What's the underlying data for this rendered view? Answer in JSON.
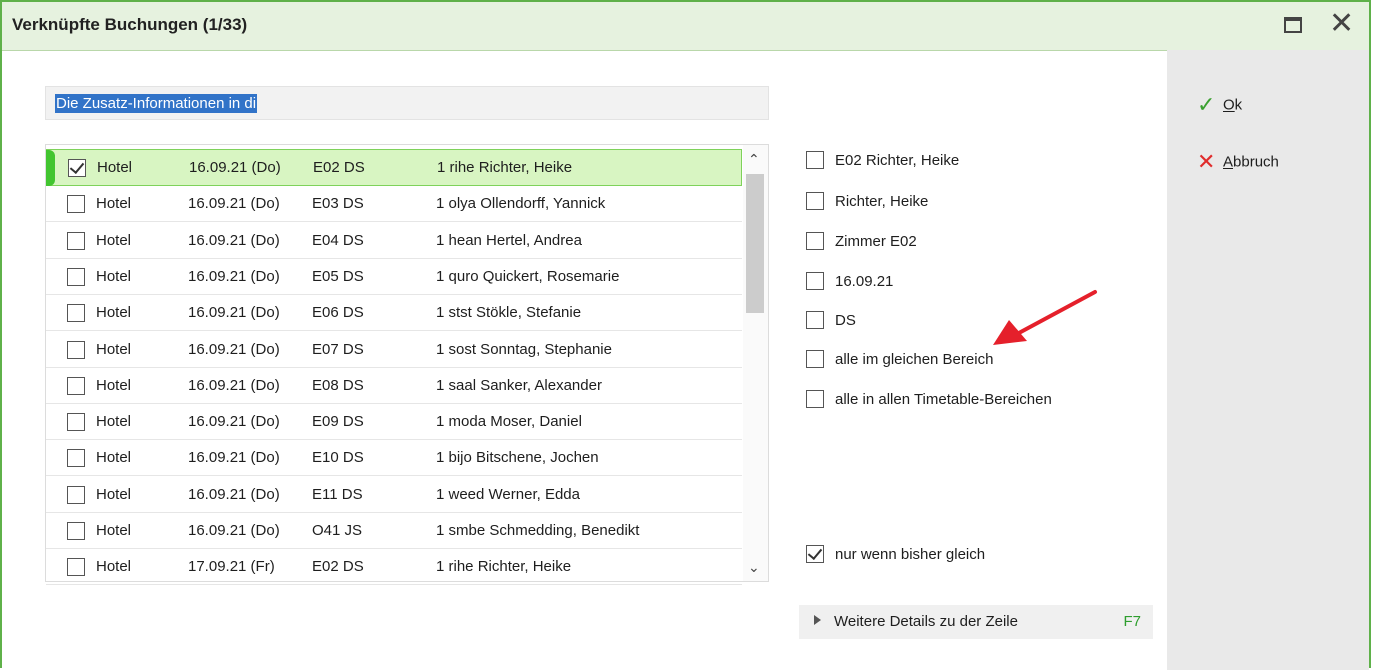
{
  "window": {
    "title": "Verknüpfte Buchungen (1/33)"
  },
  "info": {
    "selected_text": "Die Zusatz-Informationen in di"
  },
  "bookings": [
    {
      "type": "Hotel",
      "date": "16.09.21 (Do)",
      "room": "E02 DS",
      "guest": "1 rihe  Richter, Heike",
      "checked": true
    },
    {
      "type": "Hotel",
      "date": "16.09.21 (Do)",
      "room": "E03 DS",
      "guest": "1 olya  Ollendorff, Yannick",
      "checked": false
    },
    {
      "type": "Hotel",
      "date": "16.09.21 (Do)",
      "room": "E04 DS",
      "guest": "1 hean  Hertel, Andrea",
      "checked": false
    },
    {
      "type": "Hotel",
      "date": "16.09.21 (Do)",
      "room": "E05 DS",
      "guest": "1 quro  Quickert, Rosemarie",
      "checked": false
    },
    {
      "type": "Hotel",
      "date": "16.09.21 (Do)",
      "room": "E06 DS",
      "guest": "1 stst  Stökle, Stefanie",
      "checked": false
    },
    {
      "type": "Hotel",
      "date": "16.09.21 (Do)",
      "room": "E07 DS",
      "guest": "1 sost  Sonntag, Stephanie",
      "checked": false
    },
    {
      "type": "Hotel",
      "date": "16.09.21 (Do)",
      "room": "E08 DS",
      "guest": "1 saal  Sanker, Alexander",
      "checked": false
    },
    {
      "type": "Hotel",
      "date": "16.09.21 (Do)",
      "room": "E09 DS",
      "guest": "1 moda  Moser, Daniel",
      "checked": false
    },
    {
      "type": "Hotel",
      "date": "16.09.21 (Do)",
      "room": "E10 DS",
      "guest": "1 bijo  Bitschene, Jochen",
      "checked": false
    },
    {
      "type": "Hotel",
      "date": "16.09.21 (Do)",
      "room": "E11 DS",
      "guest": "1 weed  Werner, Edda",
      "checked": false
    },
    {
      "type": "Hotel",
      "date": "16.09.21 (Do)",
      "room": "O41 JS",
      "guest": "1 smbe  Schmedding, Benedikt",
      "checked": false
    },
    {
      "type": "Hotel",
      "date": "17.09.21 (Fr)",
      "room": "E02 DS",
      "guest": "1 rihe  Richter, Heike",
      "checked": false
    }
  ],
  "options": {
    "room_guest": "E02 Richter, Heike",
    "guest": "Richter, Heike",
    "room": "Zimmer E02",
    "date": "16.09.21",
    "category": "DS",
    "same_area": "alle im gleichen Bereich",
    "all_areas": "alle in allen Timetable-Bereichen",
    "only_if_same": "nur wenn bisher gleich"
  },
  "details": {
    "label": "Weitere Details zu der Zeile",
    "key": "F7"
  },
  "actions": {
    "ok_first": "O",
    "ok_rest": "k",
    "cancel_first": "A",
    "cancel_rest": "bbruch"
  },
  "icons": {
    "maximize": "maximize-icon",
    "close": "close-icon",
    "ok": "checkmark-icon",
    "cancel": "x-icon"
  },
  "colors": {
    "accent_green": "#5fb14a",
    "selected_row": "#d8f5c2",
    "selection_blue": "#3173c8",
    "arrow_red": "#e5202b"
  }
}
